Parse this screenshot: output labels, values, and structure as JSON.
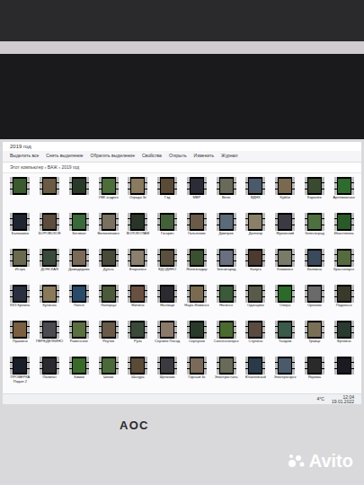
{
  "window": {
    "title": "2019 год",
    "breadcrumb": "Этот компьютер › ВАЖ › 2019 год"
  },
  "ribbon": [
    "Выделить все",
    "Снять выделение",
    "Обратить выделение",
    "Свойства",
    "Открыть",
    "Изменить",
    "Журнал"
  ],
  "thumbnails": [
    {
      "label": "",
      "color": "#3b5a2e"
    },
    {
      "label": "",
      "color": "#6b5a44"
    },
    {
      "label": "",
      "color": "#2a3a2a"
    },
    {
      "label": "УВК андрея",
      "color": "#4d6e3a"
    },
    {
      "label": "Ограда 3к",
      "color": "#8a7a60"
    },
    {
      "label": "Гзд",
      "color": "#5a4a36"
    },
    {
      "label": "МВР",
      "color": "#2c2c38"
    },
    {
      "label": "Вело",
      "color": "#6a6a5a"
    },
    {
      "label": "ВДНХ",
      "color": "#4a5a6a"
    },
    {
      "label": "Куйби",
      "color": "#7a6850"
    },
    {
      "label": "Королёв",
      "color": "#3a4a30"
    },
    {
      "label": "Артёмовская",
      "color": "#2f6b2f"
    },
    {
      "label": "Балашиха",
      "color": "#1e2430"
    },
    {
      "label": "БОРОВСКОЕ",
      "color": "#5c4c3c"
    },
    {
      "label": "Беговая",
      "color": "#3a6a3a"
    },
    {
      "label": "Волоколамск",
      "color": "#7a7060"
    },
    {
      "label": "ВОЛОКОЛАМ",
      "color": "#2a3428"
    },
    {
      "label": "Гагарин",
      "color": "#44603a"
    },
    {
      "label": "Гольяново",
      "color": "#6a5a48"
    },
    {
      "label": "Дмитров",
      "color": "#5a6a78"
    },
    {
      "label": "Долгопр",
      "color": "#8a806a"
    },
    {
      "label": "Жуковский",
      "color": "#3a3a44"
    },
    {
      "label": "Зеленоград",
      "color": "#4e7040"
    },
    {
      "label": "Ивантеевка",
      "color": "#2a5a2a"
    },
    {
      "label": "Истра",
      "color": "#6a6a50"
    },
    {
      "label": "ДОНСКАЯ",
      "color": "#3a4a3a"
    },
    {
      "label": "Домодедово",
      "color": "#7a6a58"
    },
    {
      "label": "Дубна",
      "color": "#4a4a3a"
    },
    {
      "label": "Егорьевск",
      "color": "#8a8070"
    },
    {
      "label": "ЕДОДИНО",
      "color": "#5a5040"
    },
    {
      "label": "Железнодор",
      "color": "#3a5030"
    },
    {
      "label": "Звенигород",
      "color": "#6a7080"
    },
    {
      "label": "Калуга",
      "color": "#4a3a30"
    },
    {
      "label": "Климовск",
      "color": "#7a7a6a"
    },
    {
      "label": "Коломна",
      "color": "#3a4a5a"
    },
    {
      "label": "Красногорск",
      "color": "#566a40"
    },
    {
      "label": "ККЗ Кремль",
      "color": "#2a3040"
    },
    {
      "label": "Кубинка",
      "color": "#8a7a5a"
    },
    {
      "label": "Лобня",
      "color": "#2a4a6a"
    },
    {
      "label": "Люберцы",
      "color": "#4a5a3a"
    },
    {
      "label": "Митино",
      "color": "#6a5040"
    },
    {
      "label": "Мытищи",
      "color": "#2a2a30"
    },
    {
      "label": "Наро-Фоминск",
      "color": "#7a6a50"
    },
    {
      "label": "Ногинск",
      "color": "#3a5a3a"
    },
    {
      "label": "Одинцово",
      "color": "#5a5a4a"
    },
    {
      "label": "Озёры",
      "color": "#2a6a2a"
    },
    {
      "label": "Орехово",
      "color": "#6a6a6a"
    },
    {
      "label": "Подольск",
      "color": "#3a3a2a"
    },
    {
      "label": "Пушкино",
      "color": "#7a6040"
    },
    {
      "label": "ПЕРЕДЕЛКИНО",
      "color": "#4a4a50"
    },
    {
      "label": "Раменское",
      "color": "#5a7040"
    },
    {
      "label": "Реутов",
      "color": "#6a5a48"
    },
    {
      "label": "Руза",
      "color": "#3a4a3a"
    },
    {
      "label": "Сергиев Посад",
      "color": "#8a7a6a"
    },
    {
      "label": "Серпухов",
      "color": "#2a3a2a"
    },
    {
      "label": "Солнечногорск",
      "color": "#4a6a30"
    },
    {
      "label": "Ступино",
      "color": "#5a4a40"
    },
    {
      "label": "Талдом",
      "color": "#3a5a4a"
    },
    {
      "label": "Троицк",
      "color": "#7a7058"
    },
    {
      "label": "Фрязино",
      "color": "#2a3a30"
    },
    {
      "label": "ПРОВЕРКА Подол 2",
      "color": "#1a1e2a"
    },
    {
      "label": "Полигон",
      "color": "#2a2a30"
    },
    {
      "label": "Химки",
      "color": "#3a6a2a"
    },
    {
      "label": "Чехов",
      "color": "#4a6a3a"
    },
    {
      "label": "Шатура",
      "color": "#5a4a38"
    },
    {
      "label": "Щёлково",
      "color": "#3a3a40"
    },
    {
      "label": "Горный 3к",
      "color": "#7a6a5a"
    },
    {
      "label": "Электросталь",
      "color": "#6a6a58"
    },
    {
      "label": "Юбилейный",
      "color": "#2a3a4a"
    },
    {
      "label": "Электрогорск",
      "color": "#4a5a6a"
    },
    {
      "label": "Яхрома",
      "color": "#2a2a2a"
    },
    {
      "label": "",
      "color": "#1a1a20"
    }
  ],
  "taskbar": {
    "weather": "4°C",
    "time": "12:04",
    "date": "19.01.2022"
  },
  "monitor": {
    "brand": "AOC"
  },
  "watermark": "Avito"
}
